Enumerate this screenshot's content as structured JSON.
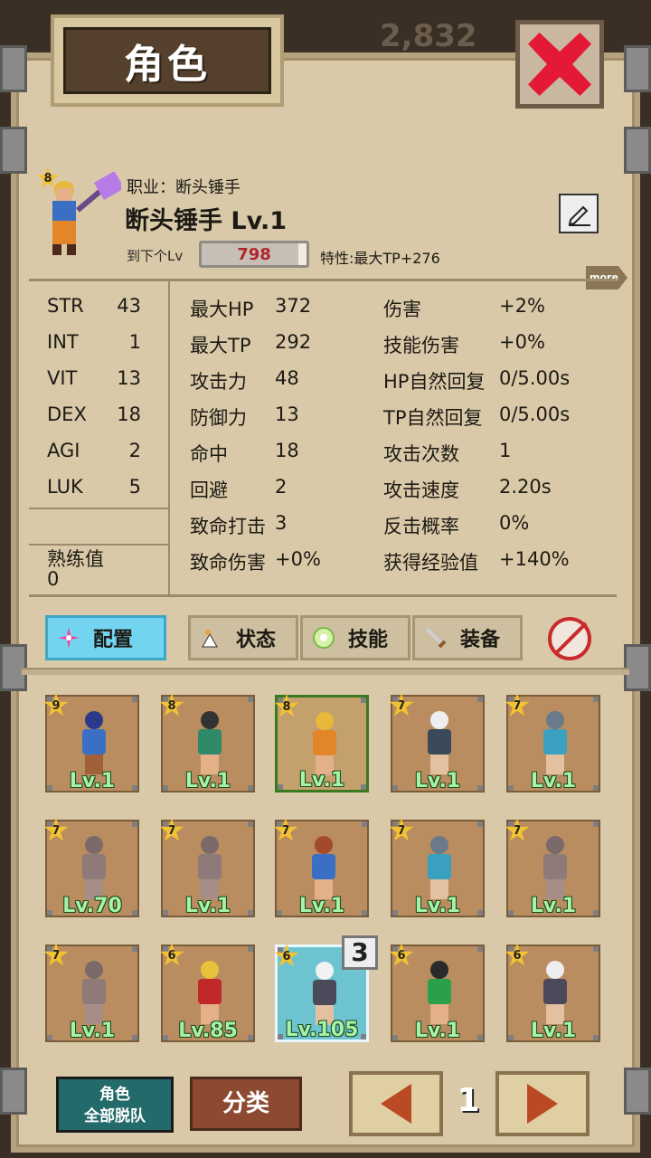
{
  "window": {
    "title": "角色",
    "coins": "2,832"
  },
  "hero": {
    "stars": "8",
    "job_label": "职业：断头锤手",
    "name": "断头锤手 Lv.1",
    "next_lv_label": "到下个Lv",
    "exp_value": "798",
    "trait": "特性:最大TP+276",
    "more_label": "more"
  },
  "stats": {
    "base": [
      {
        "name": "STR",
        "value": "43"
      },
      {
        "name": "INT",
        "value": "1"
      },
      {
        "name": "VIT",
        "value": "13"
      },
      {
        "name": "DEX",
        "value": "18"
      },
      {
        "name": "AGI",
        "value": "2"
      },
      {
        "name": "LUK",
        "value": "5"
      }
    ],
    "proficiency_label": "熟练值",
    "proficiency_value": "0",
    "mid": [
      {
        "name": "最大HP",
        "value": "372"
      },
      {
        "name": "最大TP",
        "value": "292"
      },
      {
        "name": "攻击力",
        "value": "48"
      },
      {
        "name": "防御力",
        "value": "13"
      },
      {
        "name": "命中",
        "value": "18"
      },
      {
        "name": "回避",
        "value": "2"
      },
      {
        "name": "致命打击",
        "value": "3"
      },
      {
        "name": "致命伤害",
        "value": "+0%"
      }
    ],
    "right": [
      {
        "name": "伤害",
        "value": "+2%"
      },
      {
        "name": "技能伤害",
        "value": "+0%"
      },
      {
        "name": "HP自然回复",
        "value": "0/5.00s"
      },
      {
        "name": "TP自然回复",
        "value": "0/5.00s"
      },
      {
        "name": "攻击次数",
        "value": "1"
      },
      {
        "name": "攻击速度",
        "value": "2.20s"
      },
      {
        "name": "反击概率",
        "value": "0%"
      },
      {
        "name": "获得经验值",
        "value": "+140%"
      }
    ]
  },
  "tabs": [
    {
      "label": "配置",
      "icon": "sparkle-icon"
    },
    {
      "label": "状态",
      "icon": "status-icon"
    },
    {
      "label": "技能",
      "icon": "skill-gem-icon"
    },
    {
      "label": "装备",
      "icon": "sword-icon"
    }
  ],
  "roster": [
    {
      "stars": "9",
      "lv": "Lv.1",
      "skin": "#a0603a",
      "shirt": "#3a6fc4",
      "hair": "#2a3a8a"
    },
    {
      "stars": "8",
      "lv": "Lv.1",
      "skin": "#e3b08a",
      "shirt": "#2f8a6a",
      "hair": "#333333"
    },
    {
      "stars": "8",
      "lv": "Lv.1",
      "skin": "#e3b08a",
      "shirt": "#e3862a",
      "hair": "#e8b83a"
    },
    {
      "stars": "7",
      "lv": "Lv.1",
      "skin": "#e3c0a0",
      "shirt": "#3a4a5a",
      "hair": "#eeeeee"
    },
    {
      "stars": "7",
      "lv": "Lv.1",
      "skin": "#e3c0a0",
      "shirt": "#3aa0c0",
      "hair": "#6a7a8a"
    },
    {
      "stars": "7",
      "lv": "Lv.70",
      "skin": "#a78d88",
      "shirt": "#8e7a78",
      "hair": "#7a6a6a"
    },
    {
      "stars": "7",
      "lv": "Lv.1",
      "skin": "#a78d88",
      "shirt": "#8e7a78",
      "hair": "#7a6a6a"
    },
    {
      "stars": "7",
      "lv": "Lv.1",
      "skin": "#e3b08a",
      "shirt": "#3a6fc4",
      "hair": "#a34a2a"
    },
    {
      "stars": "7",
      "lv": "Lv.1",
      "skin": "#e3c0a0",
      "shirt": "#3aa0c0",
      "hair": "#6a7a8a"
    },
    {
      "stars": "7",
      "lv": "Lv.1",
      "skin": "#a78d88",
      "shirt": "#8e7a78",
      "hair": "#7a6a6a"
    },
    {
      "stars": "7",
      "lv": "Lv.1",
      "skin": "#a78d88",
      "shirt": "#8e7a78",
      "hair": "#7a6a6a"
    },
    {
      "stars": "6",
      "lv": "Lv.85",
      "skin": "#e3b08a",
      "shirt": "#c0282a",
      "hair": "#e8c23a"
    },
    {
      "stars": "6",
      "lv": "Lv.105",
      "skin": "#e3c0a0",
      "shirt": "#4a4a5a",
      "hair": "#f2f2f2"
    },
    {
      "stars": "6",
      "lv": "Lv.1",
      "skin": "#e3b08a",
      "shirt": "#2aa04a",
      "hair": "#2a2a2a"
    },
    {
      "stars": "6",
      "lv": "Lv.1",
      "skin": "#e3c0a0",
      "shirt": "#4a4a5a",
      "hair": "#eeeeee"
    }
  ],
  "party_slot_badge": "3",
  "bottom": {
    "leave_all_line1": "角色",
    "leave_all_line2": "全部脱队",
    "sort_label": "分类",
    "page": "1"
  },
  "colors": {
    "accent_blue": "#72d4ef",
    "level_green": "#a6f2a8",
    "exp_red": "#b0262b",
    "close_red": "#e41935"
  }
}
